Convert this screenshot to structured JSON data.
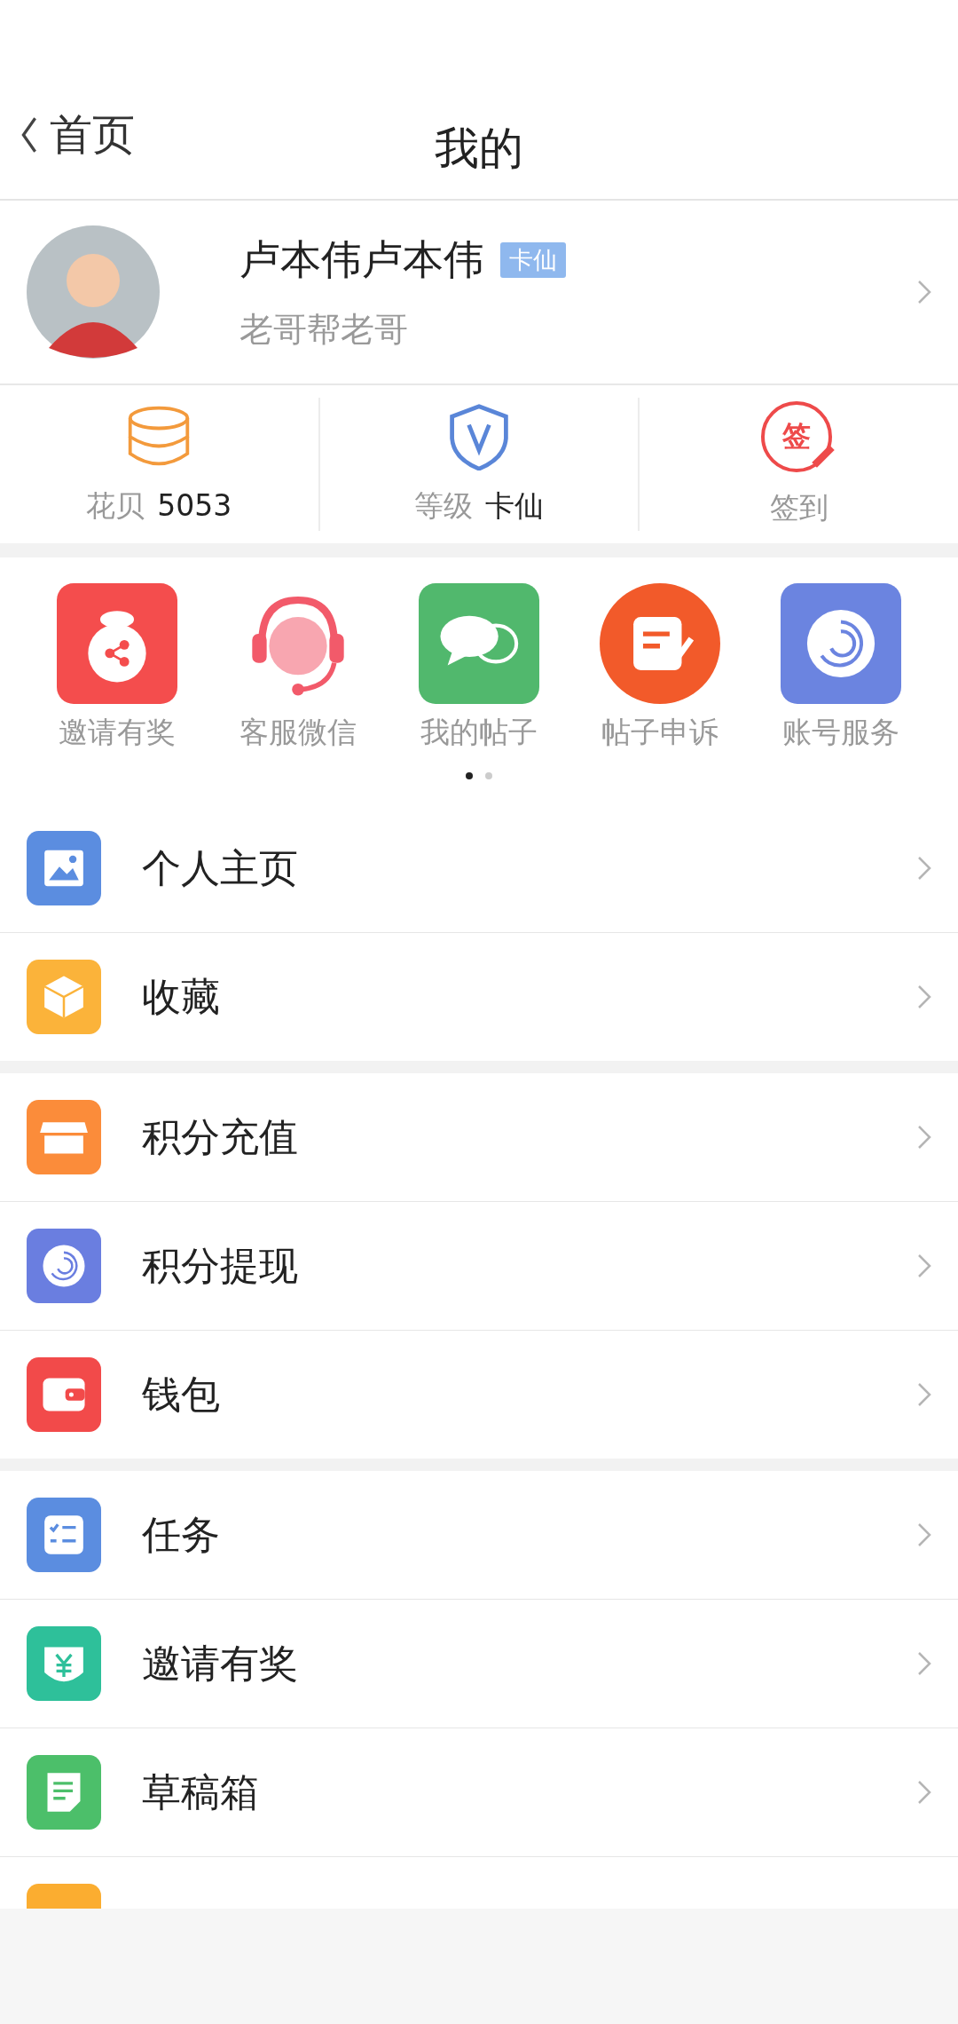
{
  "nav": {
    "back": "首页",
    "title": "我的"
  },
  "profile": {
    "name": "卢本伟卢本伟",
    "badge": "卡仙",
    "subtitle": "老哥帮老哥"
  },
  "stats": [
    {
      "kind": "coins",
      "label": "花贝",
      "value": "5053"
    },
    {
      "kind": "level",
      "label": "等级",
      "value": "卡仙"
    },
    {
      "kind": "checkin",
      "label": "签到",
      "icon_text": "签"
    }
  ],
  "shortcuts": [
    {
      "kind": "invite",
      "label": "邀请有奖"
    },
    {
      "kind": "support",
      "label": "客服微信"
    },
    {
      "kind": "posts",
      "label": "我的帖子"
    },
    {
      "kind": "appeal",
      "label": "帖子申诉"
    },
    {
      "kind": "account",
      "label": "账号服务"
    }
  ],
  "pager": [
    {
      "selected": true
    },
    {
      "selected": false
    }
  ],
  "menu_groups": [
    [
      {
        "kind": "homepage",
        "label": "个人主页"
      },
      {
        "kind": "favorites",
        "label": "收藏"
      }
    ],
    [
      {
        "kind": "recharge",
        "label": "积分充值"
      },
      {
        "kind": "withdraw",
        "label": "积分提现"
      },
      {
        "kind": "wallet",
        "label": "钱包"
      }
    ],
    [
      {
        "kind": "tasks",
        "label": "任务"
      },
      {
        "kind": "invite",
        "label": "邀请有奖"
      },
      {
        "kind": "drafts",
        "label": "草稿箱"
      },
      {
        "kind": "cut"
      }
    ]
  ]
}
